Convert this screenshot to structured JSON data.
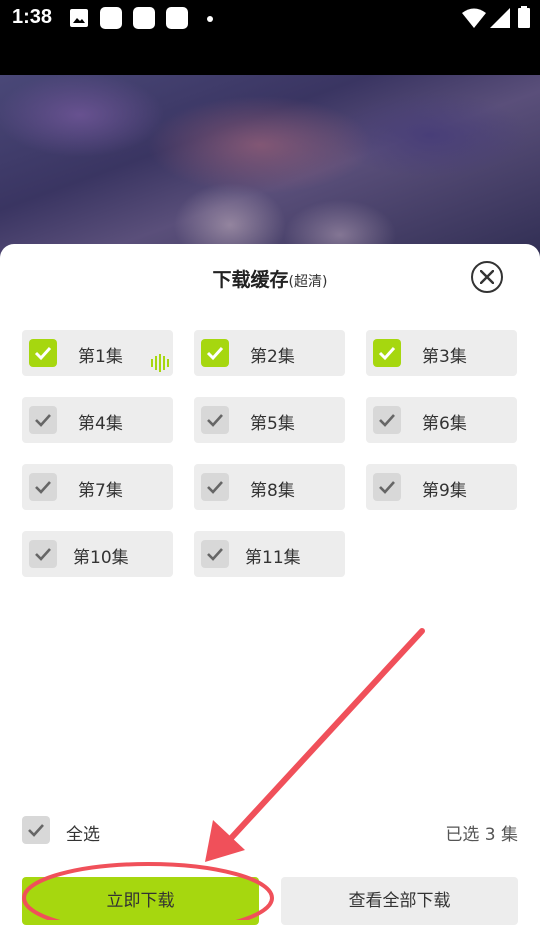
{
  "status_bar": {
    "time": "1:38"
  },
  "sheet": {
    "title": "下载缓存",
    "quality": "(超清)",
    "episodes": [
      {
        "label": "第1集",
        "selected": true
      },
      {
        "label": "第2集",
        "selected": true
      },
      {
        "label": "第3集",
        "selected": true
      },
      {
        "label": "第4集",
        "selected": false
      },
      {
        "label": "第5集",
        "selected": false
      },
      {
        "label": "第6集",
        "selected": false
      },
      {
        "label": "第7集",
        "selected": false
      },
      {
        "label": "第8集",
        "selected": false
      },
      {
        "label": "第9集",
        "selected": false
      },
      {
        "label": "第10集",
        "selected": false
      },
      {
        "label": "第11集",
        "selected": false
      }
    ],
    "select_all_label": "全选",
    "selected_count": "已选 3 集",
    "download_button": "立即下载",
    "view_all_button": "查看全部下载"
  },
  "colors": {
    "accent": "#a6d70f",
    "annotation": "#f0505a"
  }
}
